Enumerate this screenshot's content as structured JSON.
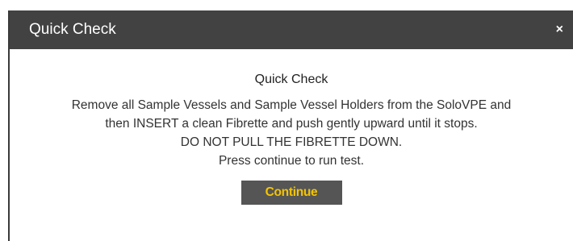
{
  "dialog": {
    "title": "Quick Check",
    "close_label": "×",
    "heading": "Quick Check",
    "lines": [
      "Remove all Sample Vessels and Sample Vessel Holders from the SoloVPE and",
      "then INSERT a clean Fibrette and push gently upward until it stops.",
      "DO NOT PULL THE FIBRETTE DOWN.",
      "Press continue to run test."
    ],
    "continue_label": "Continue"
  },
  "colors": {
    "titlebar": "#424242",
    "button_bg": "#555555",
    "button_text": "#f5c400"
  },
  "icons": {
    "close": "close-icon"
  }
}
